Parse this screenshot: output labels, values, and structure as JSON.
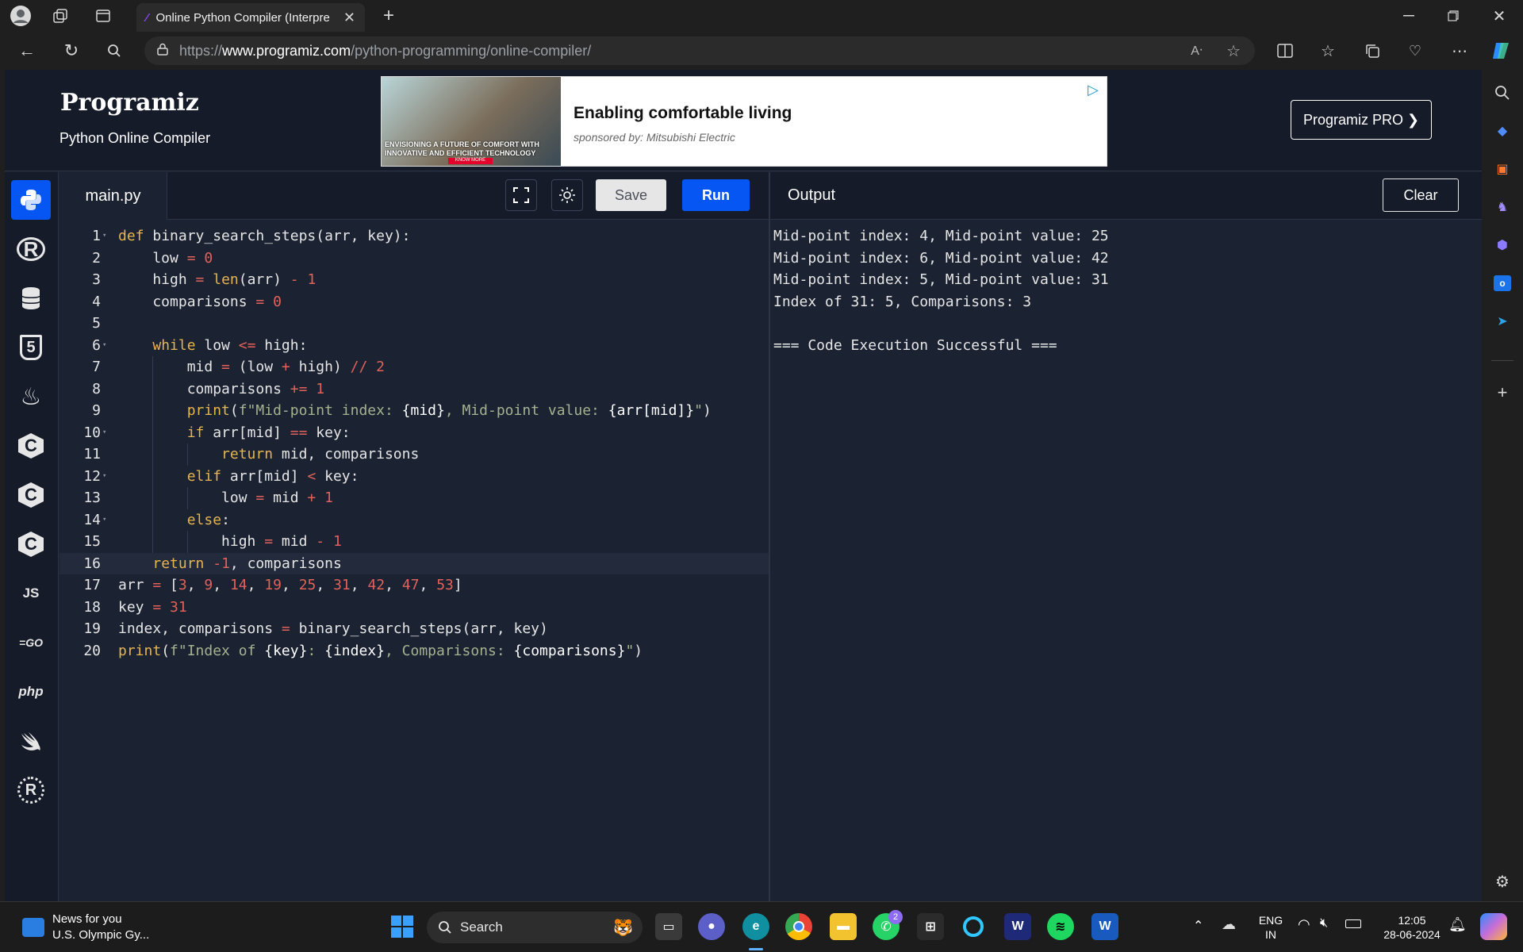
{
  "browser": {
    "tab_title": "Online Python Compiler (Interpre",
    "url_prefix": "https://",
    "url_domain": "www.programiz.com",
    "url_path": "/python-programming/online-compiler/"
  },
  "header": {
    "logo": "Programiz",
    "subtitle": "Python Online Compiler",
    "ad_title": "Enabling comfortable living",
    "ad_sponsor": "sponsored by: Mitsubishi Electric",
    "ad_image_text": "ENVISIONING A FUTURE OF COMFORT WITH INNOVATIVE AND EFFICIENT TECHNOLOGY",
    "ad_button": "KNOW MORE",
    "pro_button": "Programiz PRO ❯"
  },
  "languages": [
    {
      "id": "python",
      "label": "",
      "icon": "python-icon"
    },
    {
      "id": "r",
      "label": "R",
      "icon": "r-icon"
    },
    {
      "id": "sql",
      "label": "",
      "icon": "database-icon"
    },
    {
      "id": "html",
      "label": "5",
      "icon": "html5-icon"
    },
    {
      "id": "java",
      "label": "♨",
      "icon": "java-icon"
    },
    {
      "id": "c",
      "label": "C",
      "icon": "c-icon"
    },
    {
      "id": "cpp",
      "label": "C",
      "icon": "cpp-icon"
    },
    {
      "id": "csharp",
      "label": "C",
      "icon": "csharp-icon"
    },
    {
      "id": "js",
      "label": "JS",
      "icon": "javascript-icon"
    },
    {
      "id": "go",
      "label": "=GO",
      "icon": "go-icon"
    },
    {
      "id": "php",
      "label": "php",
      "icon": "php-icon"
    },
    {
      "id": "swift",
      "label": "",
      "icon": "swift-icon"
    },
    {
      "id": "rust",
      "label": "R",
      "icon": "rust-icon"
    }
  ],
  "editor": {
    "file_name": "main.py",
    "save_label": "Save",
    "run_label": "Run",
    "lines": [
      "def binary_search_steps(arr, key):",
      "    low = 0",
      "    high = len(arr) - 1",
      "    comparisons = 0",
      "",
      "    while low <= high:",
      "        mid = (low + high) // 2",
      "        comparisons += 1",
      "        print(f\"Mid-point index: {mid}, Mid-point value: {arr[mid]}\")",
      "        if arr[mid] == key:",
      "            return mid, comparisons",
      "        elif arr[mid] < key:",
      "            low = mid + 1",
      "        else:",
      "            high = mid - 1",
      "    return -1, comparisons",
      "arr = [3, 9, 14, 19, 25, 31, 42, 47, 53]",
      "key = 31",
      "index, comparisons = binary_search_steps(arr, key)",
      "print(f\"Index of {key}: {index}, Comparisons: {comparisons}\")"
    ]
  },
  "output": {
    "title": "Output",
    "clear_label": "Clear",
    "lines": [
      "Mid-point index: 4, Mid-point value: 25",
      "Mid-point index: 6, Mid-point value: 42",
      "Mid-point index: 5, Mid-point value: 31",
      "Index of 31: 5, Comparisons: 3",
      "",
      "=== Code Execution Successful ==="
    ]
  },
  "taskbar": {
    "news_title": "News for you",
    "news_subtitle": "U.S. Olympic Gy...",
    "search_label": "Search",
    "whatsapp_badge": "2",
    "lang_line1": "ENG",
    "lang_line2": "IN",
    "time": "12:05",
    "date": "28-06-2024"
  }
}
